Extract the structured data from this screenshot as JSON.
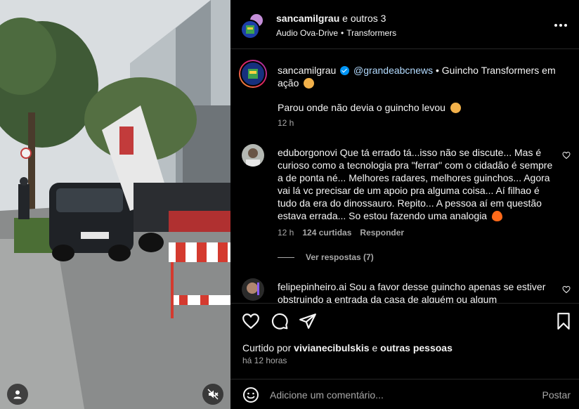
{
  "header": {
    "author": "sancamilgrau",
    "others": "e outros 3",
    "audio": "Audio Ova-Drive",
    "separator": "•",
    "tag": "Transformers"
  },
  "caption": {
    "username": "sancamilgrau",
    "mention": "@grandeabcnews",
    "text": " • Guincho Transformers em ação",
    "line2": "Parou onde não devia o guincho levou",
    "time": "12 h"
  },
  "comments": [
    {
      "username": "eduborgonovi",
      "text": "Que tá errado tá...isso não se discute... Mas é curioso como a tecnologia pra \"ferrar\" com o cidadão é sempre a de ponta né... Melhores radares, melhores guinchos... Agora vai lá vc precisar de um apoio pra alguma coisa... Aí filhao é tudo da era do dinossauro. Repito... A pessoa aí em questão estava errada... So estou fazendo uma analogia",
      "time": "12 h",
      "likes": "124 curtidas",
      "reply": "Responder",
      "view_replies": "Ver respostas (7)"
    },
    {
      "username": "felipepinheiro.ai",
      "text": "Sou a favor desse guincho apenas se estiver obstruindo a entrada da casa de alguém ou algum"
    }
  ],
  "likes_line": {
    "prefix": "Curtido por",
    "user": "vivianecibulskis",
    "connector": "e",
    "others": "outras pessoas"
  },
  "posted_ago": "há 12 horas",
  "add_comment": {
    "placeholder": "Adicione um comentário...",
    "post_label": "Postar"
  },
  "icons": {
    "more": "more-horizontal-icon",
    "like": "heart-icon",
    "comment": "comment-icon",
    "share": "share-icon",
    "save": "bookmark-icon",
    "emoji": "emoji-icon",
    "user": "user-icon",
    "mute": "mute-icon"
  },
  "colors": {
    "background": "#000000",
    "text": "#f5f5f5",
    "secondary": "#a8a8a8",
    "verified": "#0095f6",
    "divider": "#262626"
  }
}
